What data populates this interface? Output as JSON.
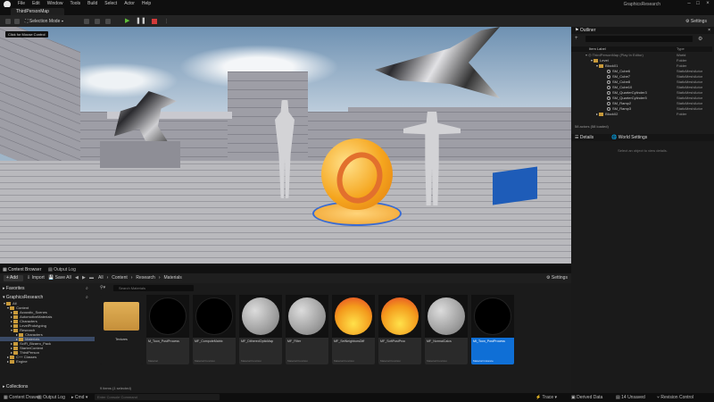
{
  "window": {
    "menu": [
      "File",
      "Edit",
      "Window",
      "Tools",
      "Build",
      "Select",
      "Actor",
      "Help"
    ],
    "project_title": "GraphicsResearch",
    "map_tab": "ThirdPersonMap"
  },
  "toolbar": {
    "selection_mode": "Selection Mode",
    "settings": "Settings"
  },
  "viewport": {
    "mouse_hint": "Click for Mouse Control"
  },
  "outliner": {
    "tab": "Outliner",
    "col_label": "Item Label",
    "col_type": "Type",
    "rows": [
      {
        "label": "ThirdPersonMap (Play In Editor)",
        "type": "World"
      },
      {
        "label": "Level",
        "type": "Folder"
      },
      {
        "label": "Block01",
        "type": "Folder"
      },
      {
        "label": "SM_Cube6",
        "type": "StaticMeshActor"
      },
      {
        "label": "SM_Cube7",
        "type": "StaticMeshActor"
      },
      {
        "label": "SM_Cube8",
        "type": "StaticMeshActor"
      },
      {
        "label": "SM_Cube10",
        "type": "StaticMeshActor"
      },
      {
        "label": "SM_QuarterCylinder3",
        "type": "StaticMeshActor"
      },
      {
        "label": "SM_QuarterCylinder5",
        "type": "StaticMeshActor"
      },
      {
        "label": "SM_Ramp2",
        "type": "StaticMeshActor"
      },
      {
        "label": "SM_Ramp3",
        "type": "StaticMeshActor"
      },
      {
        "label": "Block02",
        "type": "Folder"
      }
    ],
    "count": "58 actors (58 loaded)"
  },
  "details": {
    "tab_details": "Details",
    "tab_world": "World Settings",
    "empty_msg": "Select an object to view details."
  },
  "content_browser": {
    "tab": "Content Browser",
    "tab_log": "Output Log",
    "add": "Add",
    "import": "Import",
    "save_all": "Save All",
    "breadcrumb": [
      "All",
      "Content",
      "Research",
      "Materials"
    ],
    "settings": "Settings",
    "favorites": "Favorites",
    "project": "GraphicsResearch",
    "tree": [
      {
        "label": "All",
        "depth": 0
      },
      {
        "label": "Content",
        "depth": 1
      },
      {
        "label": "Acoustic_Scenes",
        "depth": 2
      },
      {
        "label": "AutomotiveMaterials",
        "depth": 2
      },
      {
        "label": "Characters",
        "depth": 2
      },
      {
        "label": "LevelPrototyping",
        "depth": 2
      },
      {
        "label": "Research",
        "depth": 2
      },
      {
        "label": "Characters",
        "depth": 3
      },
      {
        "label": "Materials",
        "depth": 3
      },
      {
        "label": "SciFi_Bizarro_Pack",
        "depth": 2
      },
      {
        "label": "StarterContent",
        "depth": 2
      },
      {
        "label": "ThirdPerson",
        "depth": 2
      },
      {
        "label": "C++ Classes",
        "depth": 1
      },
      {
        "label": "Engine",
        "depth": 1
      }
    ],
    "search_placeholder": "Search Materials",
    "assets": [
      {
        "name": "Textures",
        "type": "",
        "kind": "folder"
      },
      {
        "name": "M_Toon_PostProcess",
        "type": "Material",
        "kind": "black"
      },
      {
        "name": "MF_ComputeMatrix",
        "type": "Material Function",
        "kind": "black"
      },
      {
        "name": "MF_DitheredOpticMap",
        "type": "Material Function",
        "kind": "grey"
      },
      {
        "name": "MF_Filter",
        "type": "Material Function",
        "kind": "grey"
      },
      {
        "name": "MF_SetNeighborsDiff",
        "type": "Material Function",
        "kind": "orange"
      },
      {
        "name": "MF_SoftPostProc",
        "type": "Material Function",
        "kind": "orange"
      },
      {
        "name": "MF_NormalCalcs",
        "type": "Material Function",
        "kind": "grey"
      },
      {
        "name": "MI_Toon_PostProcess",
        "type": "Material Instance",
        "kind": "black-selected"
      }
    ],
    "status": "9 items (1 selected)",
    "collections": "Collections"
  },
  "statusbar": {
    "content_drawer": "Content Drawer",
    "output_log": "Output Log",
    "cmd": "Cmd",
    "console_placeholder": "Enter Console Command",
    "trace": "Trace",
    "derived_data": "Derived Data",
    "unsaved": "14 Unsaved",
    "revision": "Revision Control"
  },
  "colors": {
    "accent": "#0f6fd6",
    "play": "#5fbf3a",
    "stop": "#d13a3a"
  }
}
